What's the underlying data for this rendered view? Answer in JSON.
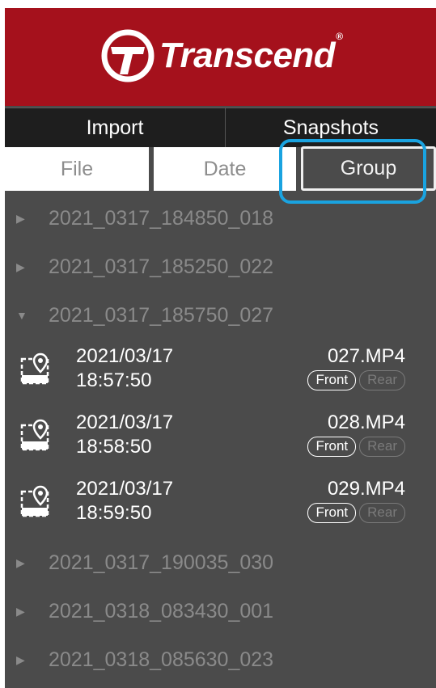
{
  "brand": {
    "name": "Transcend",
    "registered": "®"
  },
  "top_tabs": [
    "Import",
    "Snapshots"
  ],
  "sort_tabs": {
    "file": "File",
    "date": "Date",
    "group": "Group",
    "selected": "Group"
  },
  "groups_before": [
    {
      "label": "2021_0317_184850_018",
      "expanded": false
    },
    {
      "label": "2021_0317_185250_022",
      "expanded": false
    },
    {
      "label": "2021_0317_185750_027",
      "expanded": true
    }
  ],
  "files": [
    {
      "date": "2021/03/17",
      "time": "18:57:50",
      "name": "027.MP4",
      "front": "Front",
      "rear": "Rear",
      "icon": "video-location-icon"
    },
    {
      "date": "2021/03/17",
      "time": "18:58:50",
      "name": "028.MP4",
      "front": "Front",
      "rear": "Rear",
      "icon": "video-location-icon"
    },
    {
      "date": "2021/03/17",
      "time": "18:59:50",
      "name": "029.MP4",
      "front": "Front",
      "rear": "Rear",
      "icon": "video-location-icon"
    }
  ],
  "groups_after": [
    {
      "label": "2021_0317_190035_030",
      "expanded": false
    },
    {
      "label": "2021_0318_083430_001",
      "expanded": false
    },
    {
      "label": "2021_0318_085630_023",
      "expanded": false
    }
  ],
  "colors": {
    "header": "#a5111c",
    "panel": "#4b4b4b",
    "tabbar": "#1e1e1e",
    "highlight": "#1aa3e0"
  }
}
